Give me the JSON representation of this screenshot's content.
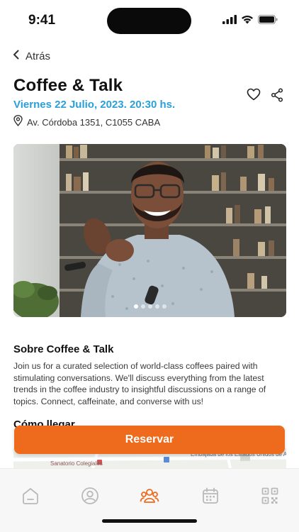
{
  "status": {
    "time": "9:41"
  },
  "nav": {
    "back_label": "Atrás"
  },
  "event": {
    "title": "Coffee & Talk",
    "date": "Viernes 22 Julio, 2023. 20:30 hs.",
    "address": "Av. Córdoba 1351, C1055 CABA"
  },
  "carousel": {
    "count": 5,
    "active": 0
  },
  "about": {
    "title": "Sobre Coffee & Talk",
    "text": "Join us for a curated selection of world-class coffees paired with stimulating conversations. We'll discuss everything from the latest trends in the coffee industry to insightful discussions on a range of topics.  Connect, caffeinate, and converse with us!"
  },
  "directions": {
    "title": "Cómo llegar",
    "map_labels": [
      "Sanatorio Colegiales",
      "Embajada de los Estados Unidos de América"
    ]
  },
  "cta": {
    "label": "Reservar"
  },
  "tabs": [
    {
      "icon": "home-icon",
      "active": false
    },
    {
      "icon": "profile-icon",
      "active": false
    },
    {
      "icon": "community-icon",
      "active": true
    },
    {
      "icon": "calendar-icon",
      "active": false
    },
    {
      "icon": "qr-code-icon",
      "active": false
    }
  ],
  "colors": {
    "accent": "#ee6a1c",
    "date": "#2a9fd8",
    "tab_inactive": "#b9b9b9"
  }
}
